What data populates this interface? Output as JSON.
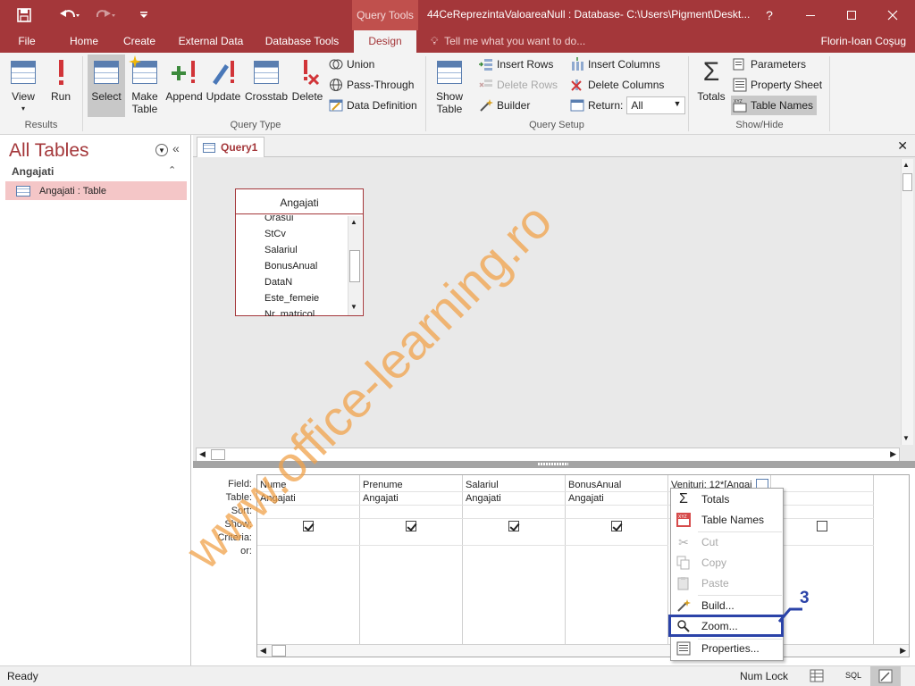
{
  "titlebar": {
    "context_tools": "Query Tools",
    "document_title": "44CeReprezintaValoareaNull : Database- C:\\Users\\Pigment\\Deskt...",
    "help": "?"
  },
  "tabs": {
    "file": "File",
    "home": "Home",
    "create": "Create",
    "external_data": "External Data",
    "database_tools": "Database Tools",
    "design": "Design",
    "tell_me": "Tell me what you want to do...",
    "user": "Florin-Ioan Coşug"
  },
  "ribbon": {
    "results": {
      "label": "Results",
      "view": "View",
      "run": "Run"
    },
    "query_type": {
      "label": "Query Type",
      "select": "Select",
      "make_table_1": "Make",
      "make_table_2": "Table",
      "append": "Append",
      "update": "Update",
      "crosstab": "Crosstab",
      "delete": "Delete",
      "union": "Union",
      "pass_through": "Pass-Through",
      "data_definition": "Data Definition"
    },
    "query_setup": {
      "label": "Query Setup",
      "show_table_1": "Show",
      "show_table_2": "Table",
      "insert_rows": "Insert Rows",
      "delete_rows": "Delete Rows",
      "builder": "Builder",
      "insert_columns": "Insert Columns",
      "delete_columns": "Delete Columns",
      "return_label": "Return:",
      "return_value": "All"
    },
    "show_hide": {
      "label": "Show/Hide",
      "totals": "Totals",
      "parameters": "Parameters",
      "property_sheet": "Property Sheet",
      "table_names": "Table Names"
    }
  },
  "nav": {
    "title": "All Tables",
    "group": "Angajati",
    "item": "Angajati : Table"
  },
  "document": {
    "tab": "Query1",
    "field_list": {
      "title": "Angajati",
      "fields": [
        "Orasul",
        "StCv",
        "Salariul",
        "BonusAnual",
        "DataN",
        "Este_femeie",
        "Nr_matricol"
      ]
    },
    "grid": {
      "row_labels": [
        "Field:",
        "Table:",
        "Sort:",
        "Show:",
        "Criteria:",
        "or:"
      ],
      "columns": [
        {
          "field": "Nume",
          "table": "Angajati",
          "show": true
        },
        {
          "field": "Prenume",
          "table": "Angajati",
          "show": true
        },
        {
          "field": "Salariul",
          "table": "Angajati",
          "show": true
        },
        {
          "field": "BonusAnual",
          "table": "Angajati",
          "show": true
        },
        {
          "field": "Venituri: 12*[Angaj",
          "table": "",
          "show": true
        },
        {
          "field": "",
          "table": "",
          "show": false
        }
      ]
    }
  },
  "context_menu": {
    "totals": "Totals",
    "table_names": "Table Names",
    "cut": "Cut",
    "copy": "Copy",
    "paste": "Paste",
    "build": "Build...",
    "zoom": "Zoom...",
    "properties": "Properties..."
  },
  "annotation": {
    "number": "3",
    "color": "#2b43a8"
  },
  "statusbar": {
    "status": "Ready",
    "num_lock": "Num Lock",
    "sql": "SQL"
  },
  "watermark": {
    "text": "www.office-learning.ro",
    "color": "#f0a14a"
  },
  "colors": {
    "accent": "#a4373a",
    "nav_selected": "#f4c6c7"
  }
}
